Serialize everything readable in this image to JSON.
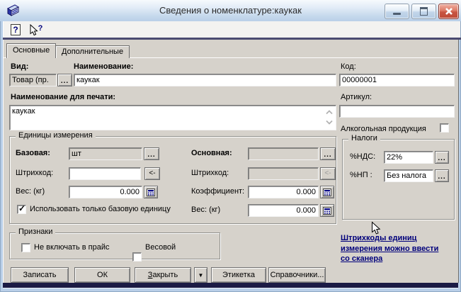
{
  "window": {
    "title": "Сведения о номенклатуре:каукак"
  },
  "icons": {
    "help_glyph": "?",
    "check_glyph": "✓"
  },
  "tabs": {
    "items": [
      "Основные",
      "Дополнительные"
    ],
    "active": "Основные"
  },
  "fields": {
    "vid": {
      "label": "Вид:",
      "value": "Товар (пр."
    },
    "name": {
      "label": "Наименование:",
      "value": "каукак"
    },
    "code": {
      "label": "Код:",
      "value": "00000001"
    },
    "print_name": {
      "label": "Наименование для печати:",
      "value": "каукак"
    },
    "articul": {
      "label": "Артикул:",
      "value": ""
    },
    "alcohol": {
      "label": "Алкогольная продукция",
      "checked": false
    }
  },
  "units_group": {
    "title": "Единицы измерения",
    "base": {
      "label": "Базовая:",
      "value": "шт"
    },
    "barcode1": {
      "label": "Штрихкод:",
      "value": ""
    },
    "weight1": {
      "label": "Вес: (кг)",
      "value": "0.000"
    },
    "only_base": {
      "label": "Использовать только базовую единицу",
      "checked": true
    },
    "main": {
      "label": "Основная:",
      "value": ""
    },
    "barcode2": {
      "label": "Штрихкод:",
      "value": ""
    },
    "coeff": {
      "label": "Коэффициент:",
      "value": "0.000"
    },
    "weight2": {
      "label": "Вес: (кг)",
      "value": "0.000"
    }
  },
  "taxes_group": {
    "title": "Налоги",
    "vat": {
      "label": "%НДС:",
      "value": "22%"
    },
    "np": {
      "label": "%НП :",
      "value": "Без налога"
    }
  },
  "flags_group": {
    "title": "Признаки",
    "no_price": {
      "label": "Не включать в прайс",
      "checked": false
    },
    "by_weight": {
      "label": "Весовой",
      "checked": false
    }
  },
  "hint": {
    "lines": [
      "Штрихкоды единиц",
      "измерения можно ввести",
      "со сканера "
    ]
  },
  "buttons": {
    "save": "Записать",
    "ok": "ОК",
    "close_first": "З",
    "close_rest": "акрыть",
    "dropdown": "▼",
    "label": "Этикетка",
    "references": "Справочники..."
  },
  "misc": {
    "dots": "...",
    "back_arrow": "<-"
  }
}
